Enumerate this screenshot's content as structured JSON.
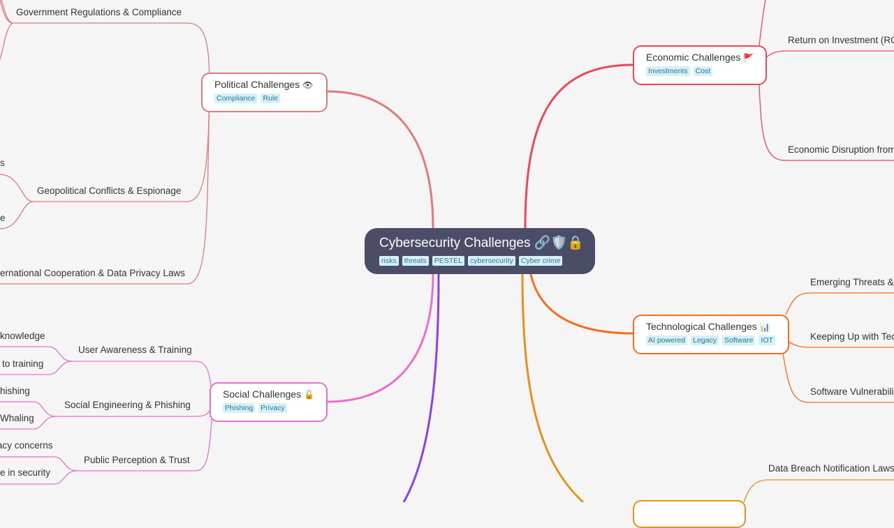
{
  "root": {
    "title": "Cybersecurity Challenges",
    "icons": [
      "link-icon",
      "shield-icon",
      "lock-icon"
    ],
    "tags": [
      "risks",
      "threats",
      "PESTEL",
      "cybersecurity",
      "Cyber crime"
    ]
  },
  "branches": {
    "political": {
      "title": "Political Challenges",
      "icon": "eye-icon",
      "color": "#e07a7a",
      "tags": [
        "Compliance",
        "Rule"
      ],
      "children": [
        "Government Regulations & Compliance",
        "Geopolitical Conflicts & Espionage",
        "ernational Cooperation & Data Privacy Laws"
      ],
      "grandchildren": [
        "s",
        "e"
      ]
    },
    "economic": {
      "title": "Economic Challenges",
      "icon": "red-flag-icon",
      "color": "#e8485a",
      "tags": [
        "Investments",
        "Cost"
      ],
      "children": [
        "Return on Investment (RO",
        "Economic Disruption from"
      ]
    },
    "technological": {
      "title": "Technological Challenges",
      "icon": "bar-chart-icon",
      "color": "#ff6a1a",
      "tags": [
        "AI powered",
        "Legacy",
        "Software",
        "IOT"
      ],
      "children": [
        "Emerging Threats &",
        "Keeping Up with Tec",
        "Software Vulnerabili"
      ]
    },
    "social": {
      "title": "Social Challenges",
      "icon": "unlocked-icon",
      "color": "#ea6fd0",
      "tags": [
        "Phishing",
        "Privacy"
      ],
      "children": [
        "User Awareness & Training",
        "Social Engineering & Phishing",
        "Public Perception & Trust"
      ],
      "grandchildren": [
        "knowledge",
        "to training",
        "hishing",
        "Whaling",
        "acy concerns",
        "e in security"
      ]
    },
    "legal": {
      "color": "#e8901a",
      "children": [
        "Data Breach Notification Laws"
      ]
    },
    "environmental": {
      "color": "#8a3ff0"
    }
  }
}
